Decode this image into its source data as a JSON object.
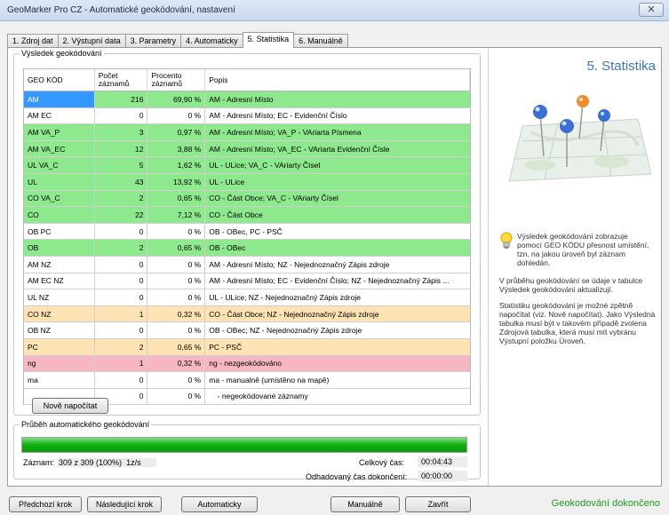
{
  "window": {
    "title": "GeoMarker Pro CZ - Automatické geokódování, nastavení",
    "close_glyph": "✕"
  },
  "tabs": [
    {
      "label": "1. Zdroj dat"
    },
    {
      "label": "2. Výstupní data"
    },
    {
      "label": "3. Parametry"
    },
    {
      "label": "4. Automaticky"
    },
    {
      "label": "5. Statistika",
      "active": true
    },
    {
      "label": "6. Manuálně"
    }
  ],
  "results": {
    "legend": "Výsledek geokódování",
    "headers": [
      "GEO KÓD",
      "Počet záznamů",
      "Procento záznamů",
      "Popis"
    ],
    "rows": [
      {
        "code": "AM",
        "count": "216",
        "percent": "69,90 %",
        "desc": "AM - Adresní Místo",
        "color": "#8ee98e"
      },
      {
        "code": "AM EC",
        "count": "0",
        "percent": "0 %",
        "desc": "AM - Adresní Místo; EC - Evidenční Číslo",
        "color": "#ffffff"
      },
      {
        "code": "AM VA_P",
        "count": "3",
        "percent": "0,97 %",
        "desc": "AM - Adresní Místo; VA_P - VAriarta Písmena",
        "color": "#8ee98e"
      },
      {
        "code": "AM VA_EC",
        "count": "12",
        "percent": "3,88 %",
        "desc": "AM - Adresní Místo; VA_EC - VAriarta Evidenční Čísle",
        "color": "#8ee98e"
      },
      {
        "code": "UL VA_C",
        "count": "5",
        "percent": "1,62 %",
        "desc": "UL - ULice; VA_C - VAriarty Čísel",
        "color": "#8ee98e"
      },
      {
        "code": "UL",
        "count": "43",
        "percent": "13,92 %",
        "desc": "UL - ULice",
        "color": "#8ee98e"
      },
      {
        "code": "CO VA_C",
        "count": "2",
        "percent": "0,65 %",
        "desc": "CO - Část Obce; VA_C - VAriarty Čísel",
        "color": "#8ee98e"
      },
      {
        "code": "CO",
        "count": "22",
        "percent": "7,12 %",
        "desc": "CO - Část Obce",
        "color": "#8ee98e"
      },
      {
        "code": "OB PC",
        "count": "0",
        "percent": "0 %",
        "desc": "OB - OBec, PC - PSČ",
        "color": "#ffffff"
      },
      {
        "code": "OB",
        "count": "2",
        "percent": "0,65 %",
        "desc": "OB - OBec",
        "color": "#8ee98e"
      },
      {
        "code": "AM NZ",
        "count": "0",
        "percent": "0 %",
        "desc": "AM - Adresní Místo; NZ - Nejednoznačný Zápis zdroje",
        "color": "#ffffff"
      },
      {
        "code": "AM EC NZ",
        "count": "0",
        "percent": "0 %",
        "desc": "AM - Adresní Místo; EC - Evidenční Číslo; NZ - Nejednoznačný Zápis ...",
        "color": "#ffffff"
      },
      {
        "code": "UL NZ",
        "count": "0",
        "percent": "0 %",
        "desc": "UL - ULice; NZ - Nejednoznačný Zápis zdroje",
        "color": "#ffffff"
      },
      {
        "code": "CO NZ",
        "count": "1",
        "percent": "0,32 %",
        "desc": "CO - Část Obce; NZ - Nejednoznačný Zápis zdroje",
        "color": "#fde2b3"
      },
      {
        "code": "OB NZ",
        "count": "0",
        "percent": "0 %",
        "desc": "OB - OBec; NZ - Nejednoznačný Zápis zdroje",
        "color": "#ffffff"
      },
      {
        "code": "PC",
        "count": "2",
        "percent": "0,65 %",
        "desc": "PC - PSČ",
        "color": "#fde2b3"
      },
      {
        "code": "ng",
        "count": "1",
        "percent": "0,32 %",
        "desc": "ng - nezgeokódováno",
        "color": "#f7b7c2"
      },
      {
        "code": "ma",
        "count": "0",
        "percent": "0 %",
        "desc": "ma - manualně (umístěno na mapě)",
        "color": "#ffffff"
      },
      {
        "code": "",
        "count": "0",
        "percent": "0 %",
        "desc": "    - negeokódované záznamy",
        "color": "#ffffff"
      }
    ],
    "recalc_label": "Nově napočítat"
  },
  "progress": {
    "legend": "Průběh automatického geokódování",
    "fraction": 1.0,
    "record_label": "Záznam:",
    "record_value": "309 z 309 (100%)",
    "rate": "1z/s",
    "total_time_label": "Celkový čas:",
    "total_time": "00:04:43",
    "eta_label": "Odhadovaný čas dokončení:",
    "eta": "00:00:00"
  },
  "side": {
    "heading": "5. Statistika",
    "tip_icon": "lightbulb-icon",
    "tip": "Výsledek geokódování zobrazuje pomocí GEO KÓDU přesnost umístění, tzn. na jakou úroveň byl záznam dohledán.",
    "p1": "V průběhu geokódování se údaje v tabulce Výsledek geokódování aktualizují.",
    "p2": "Statistiku geokódování je možné zpětně napočítat (viz. Nově napočítat). Jako Výsledná tabulka musí být v takovém případě zvolena Zdrojová tabulka, která musí mít vybránu Výstupní položku Úroveň."
  },
  "buttons": {
    "prev": "Předchozí krok",
    "next": "Následující krok",
    "auto": "Automaticky",
    "manual": "Manuálně",
    "close": "Zavřít"
  },
  "status": "Geokodování dokončeno"
}
